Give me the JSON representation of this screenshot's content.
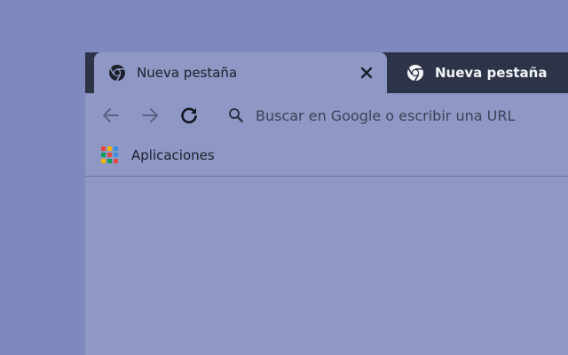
{
  "tabs": [
    {
      "title": "Nueva pestaña",
      "active": true,
      "icon": "chrome-icon"
    },
    {
      "title": "Nueva pestaña",
      "active": false,
      "icon": "chrome-icon"
    }
  ],
  "toolbar": {
    "back_icon": "arrow-left-icon",
    "forward_icon": "arrow-right-icon",
    "reload_icon": "reload-icon",
    "omnibox_placeholder": "Buscar en Google o escribir una URL"
  },
  "bookmarks": [
    {
      "label": "Aplicaciones",
      "icon": "apps-grid-icon"
    }
  ],
  "colors": {
    "desktop": "#8089bf",
    "tabstrip": "#2e3447",
    "chrome_surface": "#8f98c4",
    "apps_grid": [
      "#e8453c",
      "#f4b400",
      "#3b8de0",
      "#0f9d58",
      "#e8453c",
      "#3b8de0",
      "#f4b400",
      "#0f9d58",
      "#e8453c"
    ]
  }
}
